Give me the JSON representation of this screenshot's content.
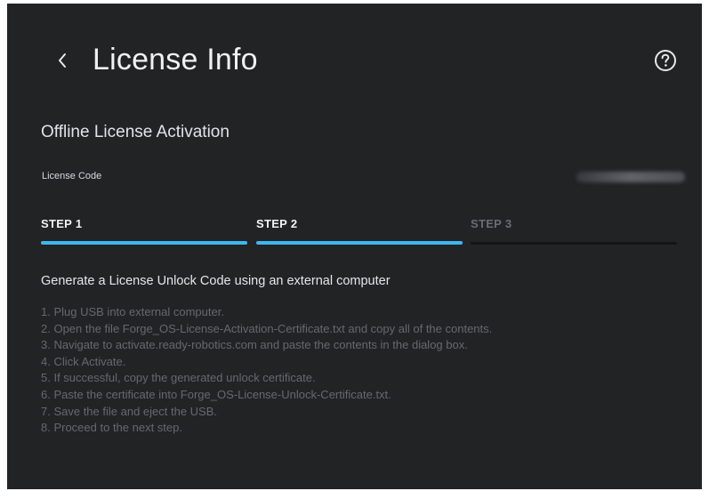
{
  "header": {
    "title": "License Info",
    "back_icon": "chevron-left-icon",
    "help_icon": "question-circle-icon"
  },
  "section": {
    "title": "Offline License Activation"
  },
  "license": {
    "label": "License Code"
  },
  "steps": [
    {
      "label": "STEP 1",
      "state": "complete"
    },
    {
      "label": "STEP 2",
      "state": "active"
    },
    {
      "label": "STEP 3",
      "state": "inactive"
    }
  ],
  "instructions": {
    "heading": "Generate a License Unlock Code using an external computer",
    "items": [
      "1. Plug USB into external computer.",
      "2. Open the file Forge_OS-License-Activation-Certificate.txt and copy all of the contents.",
      "3. Navigate to activate.ready-robotics.com and paste the contents in the dialog box.",
      "4. Click Activate.",
      "5. If successful, copy the generated unlock certificate.",
      "6. Paste the certificate into Forge_OS-License-Unlock-Certificate.txt.",
      "7. Save the file and eject the USB.",
      "8. Proceed to the next step."
    ]
  },
  "colors": {
    "background": "#222325",
    "accent": "#3fb6f2",
    "text_primary": "#f0f1f3",
    "text_muted": "#66686c"
  }
}
